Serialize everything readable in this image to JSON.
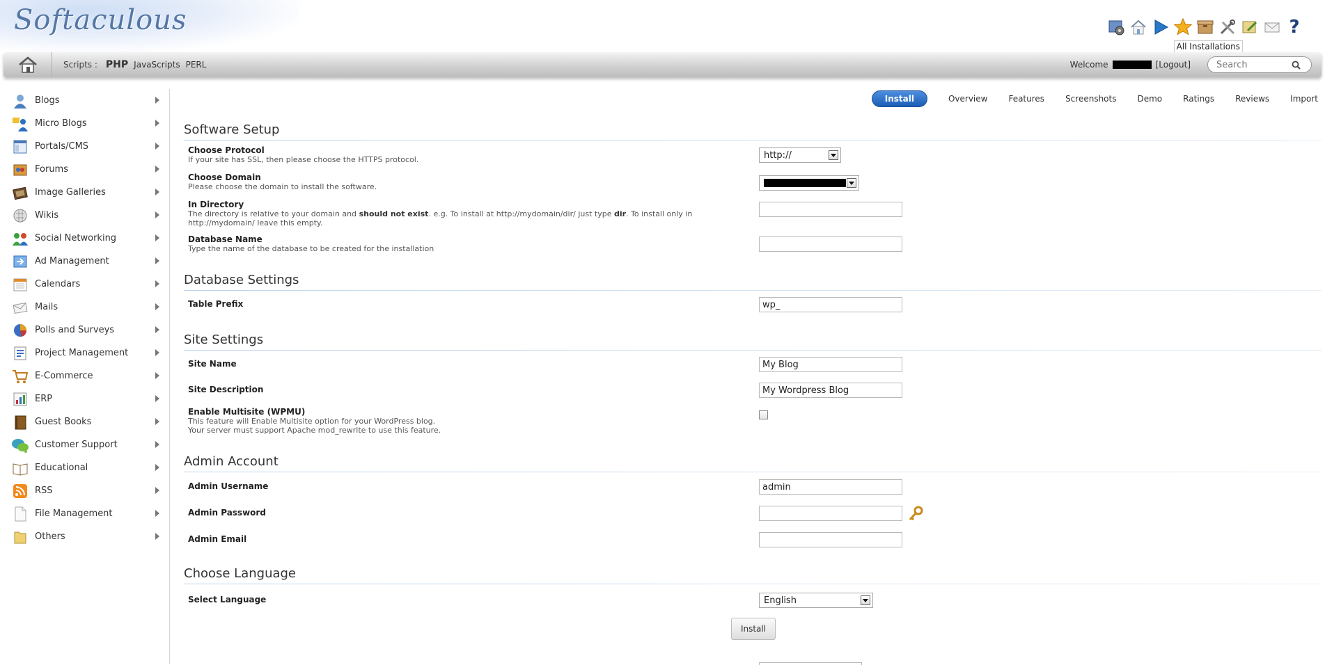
{
  "header": {
    "logo_text": "Softaculous",
    "tooltip": "All Installations",
    "icons": [
      "cpanel-icon",
      "home-icon",
      "play-icon",
      "star-icon",
      "box-icon",
      "tools-icon",
      "edit-icon",
      "mail-icon",
      "help-icon"
    ]
  },
  "navbar": {
    "scripts_label": "Scripts :",
    "links": [
      "PHP",
      "JavaScripts",
      "PERL"
    ],
    "welcome": "Welcome",
    "logout": "[Logout]",
    "search_placeholder": "Search"
  },
  "sidebar": {
    "items": [
      {
        "label": "Blogs",
        "icon": "person-icon"
      },
      {
        "label": "Micro Blogs",
        "icon": "people-icon"
      },
      {
        "label": "Portals/CMS",
        "icon": "window-icon"
      },
      {
        "label": "Forums",
        "icon": "forum-icon"
      },
      {
        "label": "Image Galleries",
        "icon": "gallery-icon"
      },
      {
        "label": "Wikis",
        "icon": "puzzle-icon"
      },
      {
        "label": "Social Networking",
        "icon": "social-icon"
      },
      {
        "label": "Ad Management",
        "icon": "ad-icon"
      },
      {
        "label": "Calendars",
        "icon": "calendar-icon"
      },
      {
        "label": "Mails",
        "icon": "envelope-icon"
      },
      {
        "label": "Polls and Surveys",
        "icon": "pie-icon"
      },
      {
        "label": "Project Management",
        "icon": "project-icon"
      },
      {
        "label": "E-Commerce",
        "icon": "cart-icon"
      },
      {
        "label": "ERP",
        "icon": "erp-icon"
      },
      {
        "label": "Guest Books",
        "icon": "book-icon"
      },
      {
        "label": "Customer Support",
        "icon": "support-icon"
      },
      {
        "label": "Educational",
        "icon": "open-book-icon"
      },
      {
        "label": "RSS",
        "icon": "rss-icon"
      },
      {
        "label": "File Management",
        "icon": "file-icon"
      },
      {
        "label": "Others",
        "icon": "folder-icon"
      }
    ]
  },
  "tabs": [
    "Install",
    "Overview",
    "Features",
    "Screenshots",
    "Demo",
    "Ratings",
    "Reviews",
    "Import"
  ],
  "form": {
    "software_setup": {
      "title": "Software Setup",
      "protocol_label": "Choose Protocol",
      "protocol_help": "If your site has SSL, then please choose the HTTPS protocol.",
      "protocol_value": "http://",
      "domain_label": "Choose Domain",
      "domain_help": "Please choose the domain to install the software.",
      "directory_label": "In Directory",
      "directory_help_1": "The directory is relative to your domain and ",
      "directory_help_bold": "should not exist",
      "directory_help_2": ". e.g. To install at http://mydomain/dir/ just type ",
      "directory_help_dir": "dir",
      "directory_help_3": ". To install only in",
      "directory_help_4": "http://mydomain/ leave this empty.",
      "directory_value": "",
      "dbname_label": "Database Name",
      "dbname_help": "Type the name of the database to be created for the installation",
      "dbname_value": ""
    },
    "database_settings": {
      "title": "Database Settings",
      "prefix_label": "Table Prefix",
      "prefix_value": "wp_"
    },
    "site_settings": {
      "title": "Site Settings",
      "site_name_label": "Site Name",
      "site_name_value": "My Blog",
      "site_desc_label": "Site Description",
      "site_desc_value": "My Wordpress Blog",
      "multisite_label": "Enable Multisite (WPMU)",
      "multisite_help_1": "This feature will Enable Multisite option for your WordPress blog.",
      "multisite_help_2": "Your server must support Apache mod_rewrite to use this feature."
    },
    "admin_account": {
      "title": "Admin Account",
      "username_label": "Admin Username",
      "username_value": "admin",
      "password_label": "Admin Password",
      "password_value": "",
      "email_label": "Admin Email",
      "email_value": ""
    },
    "language": {
      "title": "Choose Language",
      "select_label": "Select Language",
      "selected": "English"
    },
    "install_button": "Install"
  },
  "colors": {
    "accent": "#1a5db5",
    "heading_rule": "#bcd5ef",
    "logo": "#5577a5"
  }
}
